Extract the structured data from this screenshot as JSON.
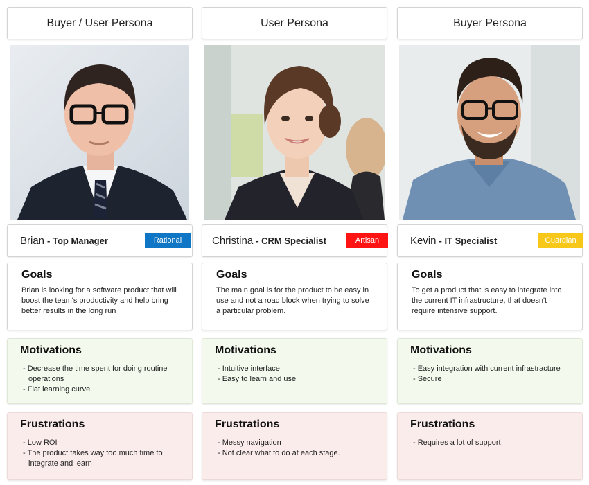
{
  "personas": [
    {
      "header": "Buyer / User Persona",
      "name": "Brian",
      "role": "- Top Manager",
      "tag": "Rational",
      "goals_title": "Goals",
      "goals_text": "Brian is looking for a software product that will boost the team's productivity and help bring better results in the long run",
      "motivations_title": "Motivations",
      "motivations": [
        "- Decrease the time spent for doing routine operations",
        "- Flat learning curve"
      ],
      "frustrations_title": "Frustrations",
      "frustrations": [
        "- Low ROI",
        "- The product takes way too much time to integrate and learn"
      ]
    },
    {
      "header": "User Persona",
      "name": "Christina",
      "role": "- CRM Specialist",
      "tag": "Artisan",
      "goals_title": "Goals",
      "goals_text": "The main goal is for the product to be easy in use and not a road block when trying to solve a particular problem.",
      "motivations_title": "Motivations",
      "motivations": [
        "- Intuitive interface",
        "- Easy to learn and use"
      ],
      "frustrations_title": "Frustrations",
      "frustrations": [
        "- Messy navigation",
        "- Not clear what to do at each stage."
      ]
    },
    {
      "header": "Buyer Persona",
      "name": "Kevin",
      "role": "- IT Specialist",
      "tag": "Guardian",
      "goals_title": "Goals",
      "goals_text": "To get a product that is easy to integrate into the current IT infrastructure, that doesn't require intensive support.",
      "motivations_title": "Motivations",
      "motivations": [
        "- Easy integration with current infrastracture",
        "- Secure"
      ],
      "frustrations_title": "Frustrations",
      "frustrations": [
        "- Requires a lot of support"
      ]
    }
  ],
  "colors": {
    "rational": "#0f76c6",
    "artisan": "#ff1313",
    "guardian": "#f7c81a",
    "motivations_bg": "#f3faed",
    "frustrations_bg": "#fbecec"
  }
}
